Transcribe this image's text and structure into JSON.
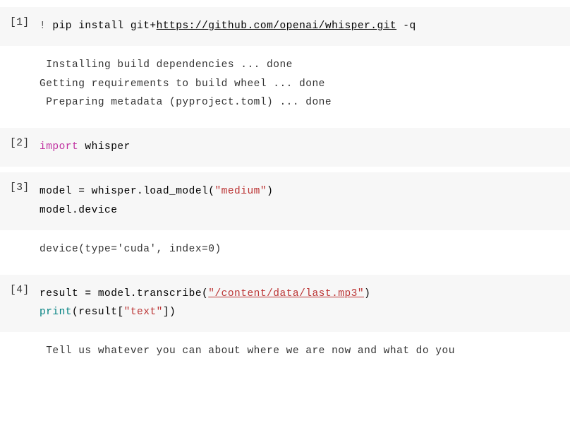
{
  "cells": [
    {
      "label": "[1]",
      "code": {
        "parts": {
          "bang": "!",
          "pip": " pip install git+",
          "url": "https://github.com/openai/whisper.git",
          "flag": " -q"
        }
      },
      "output": " Installing build dependencies ... done\nGetting requirements to build wheel ... done\n Preparing metadata (pyproject.toml) ... done"
    },
    {
      "label": "[2]",
      "code": {
        "parts": {
          "import_kw": "import",
          "module": " whisper"
        }
      }
    },
    {
      "label": "[3]",
      "code": {
        "parts": {
          "line1_pre": "model = whisper.load_model(",
          "line1_str": "\"medium\"",
          "line1_post": ")",
          "line2": "model.device"
        }
      },
      "output": "device(type='cuda', index=0)"
    },
    {
      "label": "[4]",
      "code": {
        "parts": {
          "line1_pre": "result = model.transcribe(",
          "line1_str": "\"/content/data/last.mp3\"",
          "line1_post": ")",
          "line2_print": "print",
          "line2_result": "(result[",
          "line2_str": "\"text\"",
          "line2_end": "])"
        }
      },
      "output": " Tell us whatever you can about where we are now and what do you"
    }
  ]
}
